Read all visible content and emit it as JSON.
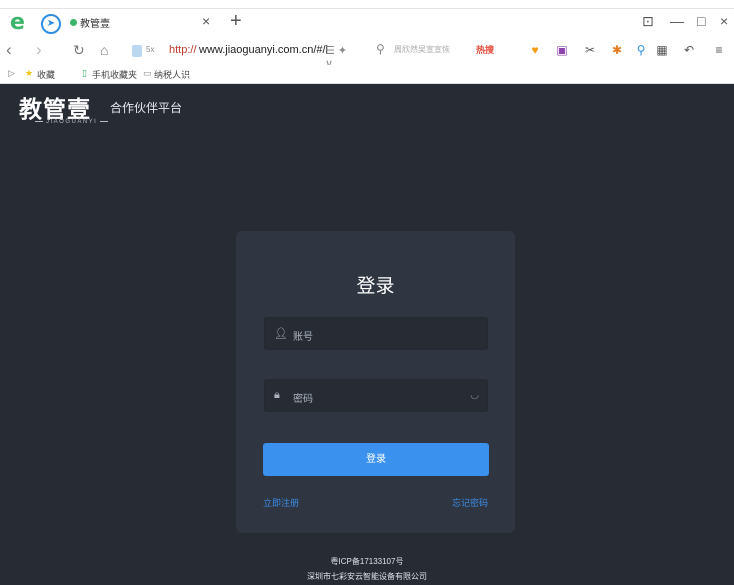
{
  "browser": {
    "tab_title": "教管壹",
    "tab_close": "×",
    "tab_add": "+",
    "window_controls": [
      "⊡",
      "—",
      "□",
      "×"
    ],
    "address": {
      "security_badge": "5x",
      "protocol": "http://",
      "url": "www.jiaoguanyi.com.cn/#/l",
      "tools": "☰ ✦ ∨"
    },
    "search": {
      "placeholder": "周欣然吴宣宣恢",
      "hot": "热搜"
    },
    "favorites": [
      "收藏",
      "手机收藏夹",
      "纳税人识"
    ]
  },
  "page": {
    "brand": "教管壹",
    "brand_pinyin": "JIAOGUANYI",
    "brand_tagline": "合作伙伴平台",
    "login": {
      "title": "登录",
      "account_placeholder": "账号",
      "password_placeholder": "密码",
      "button_label": "登录",
      "register_link": "立即注册",
      "forgot_link": "忘记密码"
    },
    "footer": {
      "icp": "粤ICP备17133107号",
      "company": "深圳市七彩安云智能设备有限公司"
    }
  },
  "colors": {
    "page_bg": "#262b34",
    "card_bg": "#2f3541",
    "accent": "#3a91ee"
  }
}
